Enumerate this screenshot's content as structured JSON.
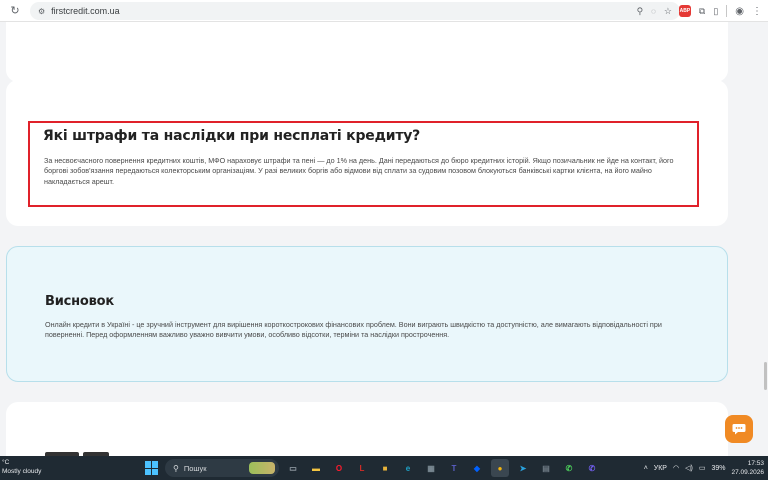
{
  "browser": {
    "url": "firstcredit.com.ua",
    "adblock_badge": "ABP"
  },
  "penalties": {
    "title": "Які штрафи та наслідки при несплаті кредиту?",
    "text": "За несвоєчасного повернення кредитних коштів, МФО нараховує штрафи та пені — до 1% на день. Дані передаються до бюро кредитних історій. Якщо позичальник не йде на контакт, його боргові зобов'язання передаються колекторським організаціям. У разі великих боргів або відмови від сплати за судовим позовом блокуються банківські картки клієнта, на його майно накладається арешт."
  },
  "conclusion": {
    "title": "Висновок",
    "text": "Онлайн кредити в Україні - це зручний інструмент для вирішення короткострокових фінансових проблем. Вони виграють швидкістю та доступністю, але вимагають відповідальності при поверненні. Перед оформленням важливо уважно вивчити умови, особливо відсотки, терміни та наслідки прострочення."
  },
  "taskbar": {
    "weather_temp": "°C",
    "weather_desc": "Mostly cloudy",
    "search_placeholder": "Пошук",
    "language": "УКР",
    "battery": "39%",
    "time": "17:53",
    "date": "27.09.2026",
    "apps": [
      {
        "name": "task-view",
        "glyph": "▭",
        "color": "#9aa5ad"
      },
      {
        "name": "file-explorer",
        "glyph": "▬",
        "color": "#f4c542"
      },
      {
        "name": "opera",
        "glyph": "O",
        "color": "#ff1b2d"
      },
      {
        "name": "lastpass",
        "glyph": "L",
        "color": "#d32d27"
      },
      {
        "name": "sticky",
        "glyph": "■",
        "color": "#e8b33a"
      },
      {
        "name": "edge",
        "glyph": "e",
        "color": "#1fa3c9"
      },
      {
        "name": "store",
        "glyph": "▦",
        "color": "#7c8b95"
      },
      {
        "name": "teams",
        "glyph": "T",
        "color": "#5b5fc7"
      },
      {
        "name": "dropbox",
        "glyph": "◆",
        "color": "#0061ff"
      },
      {
        "name": "chrome",
        "glyph": "●",
        "color": "#f2b40f"
      },
      {
        "name": "telegram",
        "glyph": "➤",
        "color": "#2aa3df"
      },
      {
        "name": "files",
        "glyph": "▤",
        "color": "#6e7a84"
      },
      {
        "name": "whatsapp",
        "glyph": "✆",
        "color": "#4ccf5b"
      },
      {
        "name": "viber",
        "glyph": "✆",
        "color": "#7360f2"
      }
    ]
  }
}
